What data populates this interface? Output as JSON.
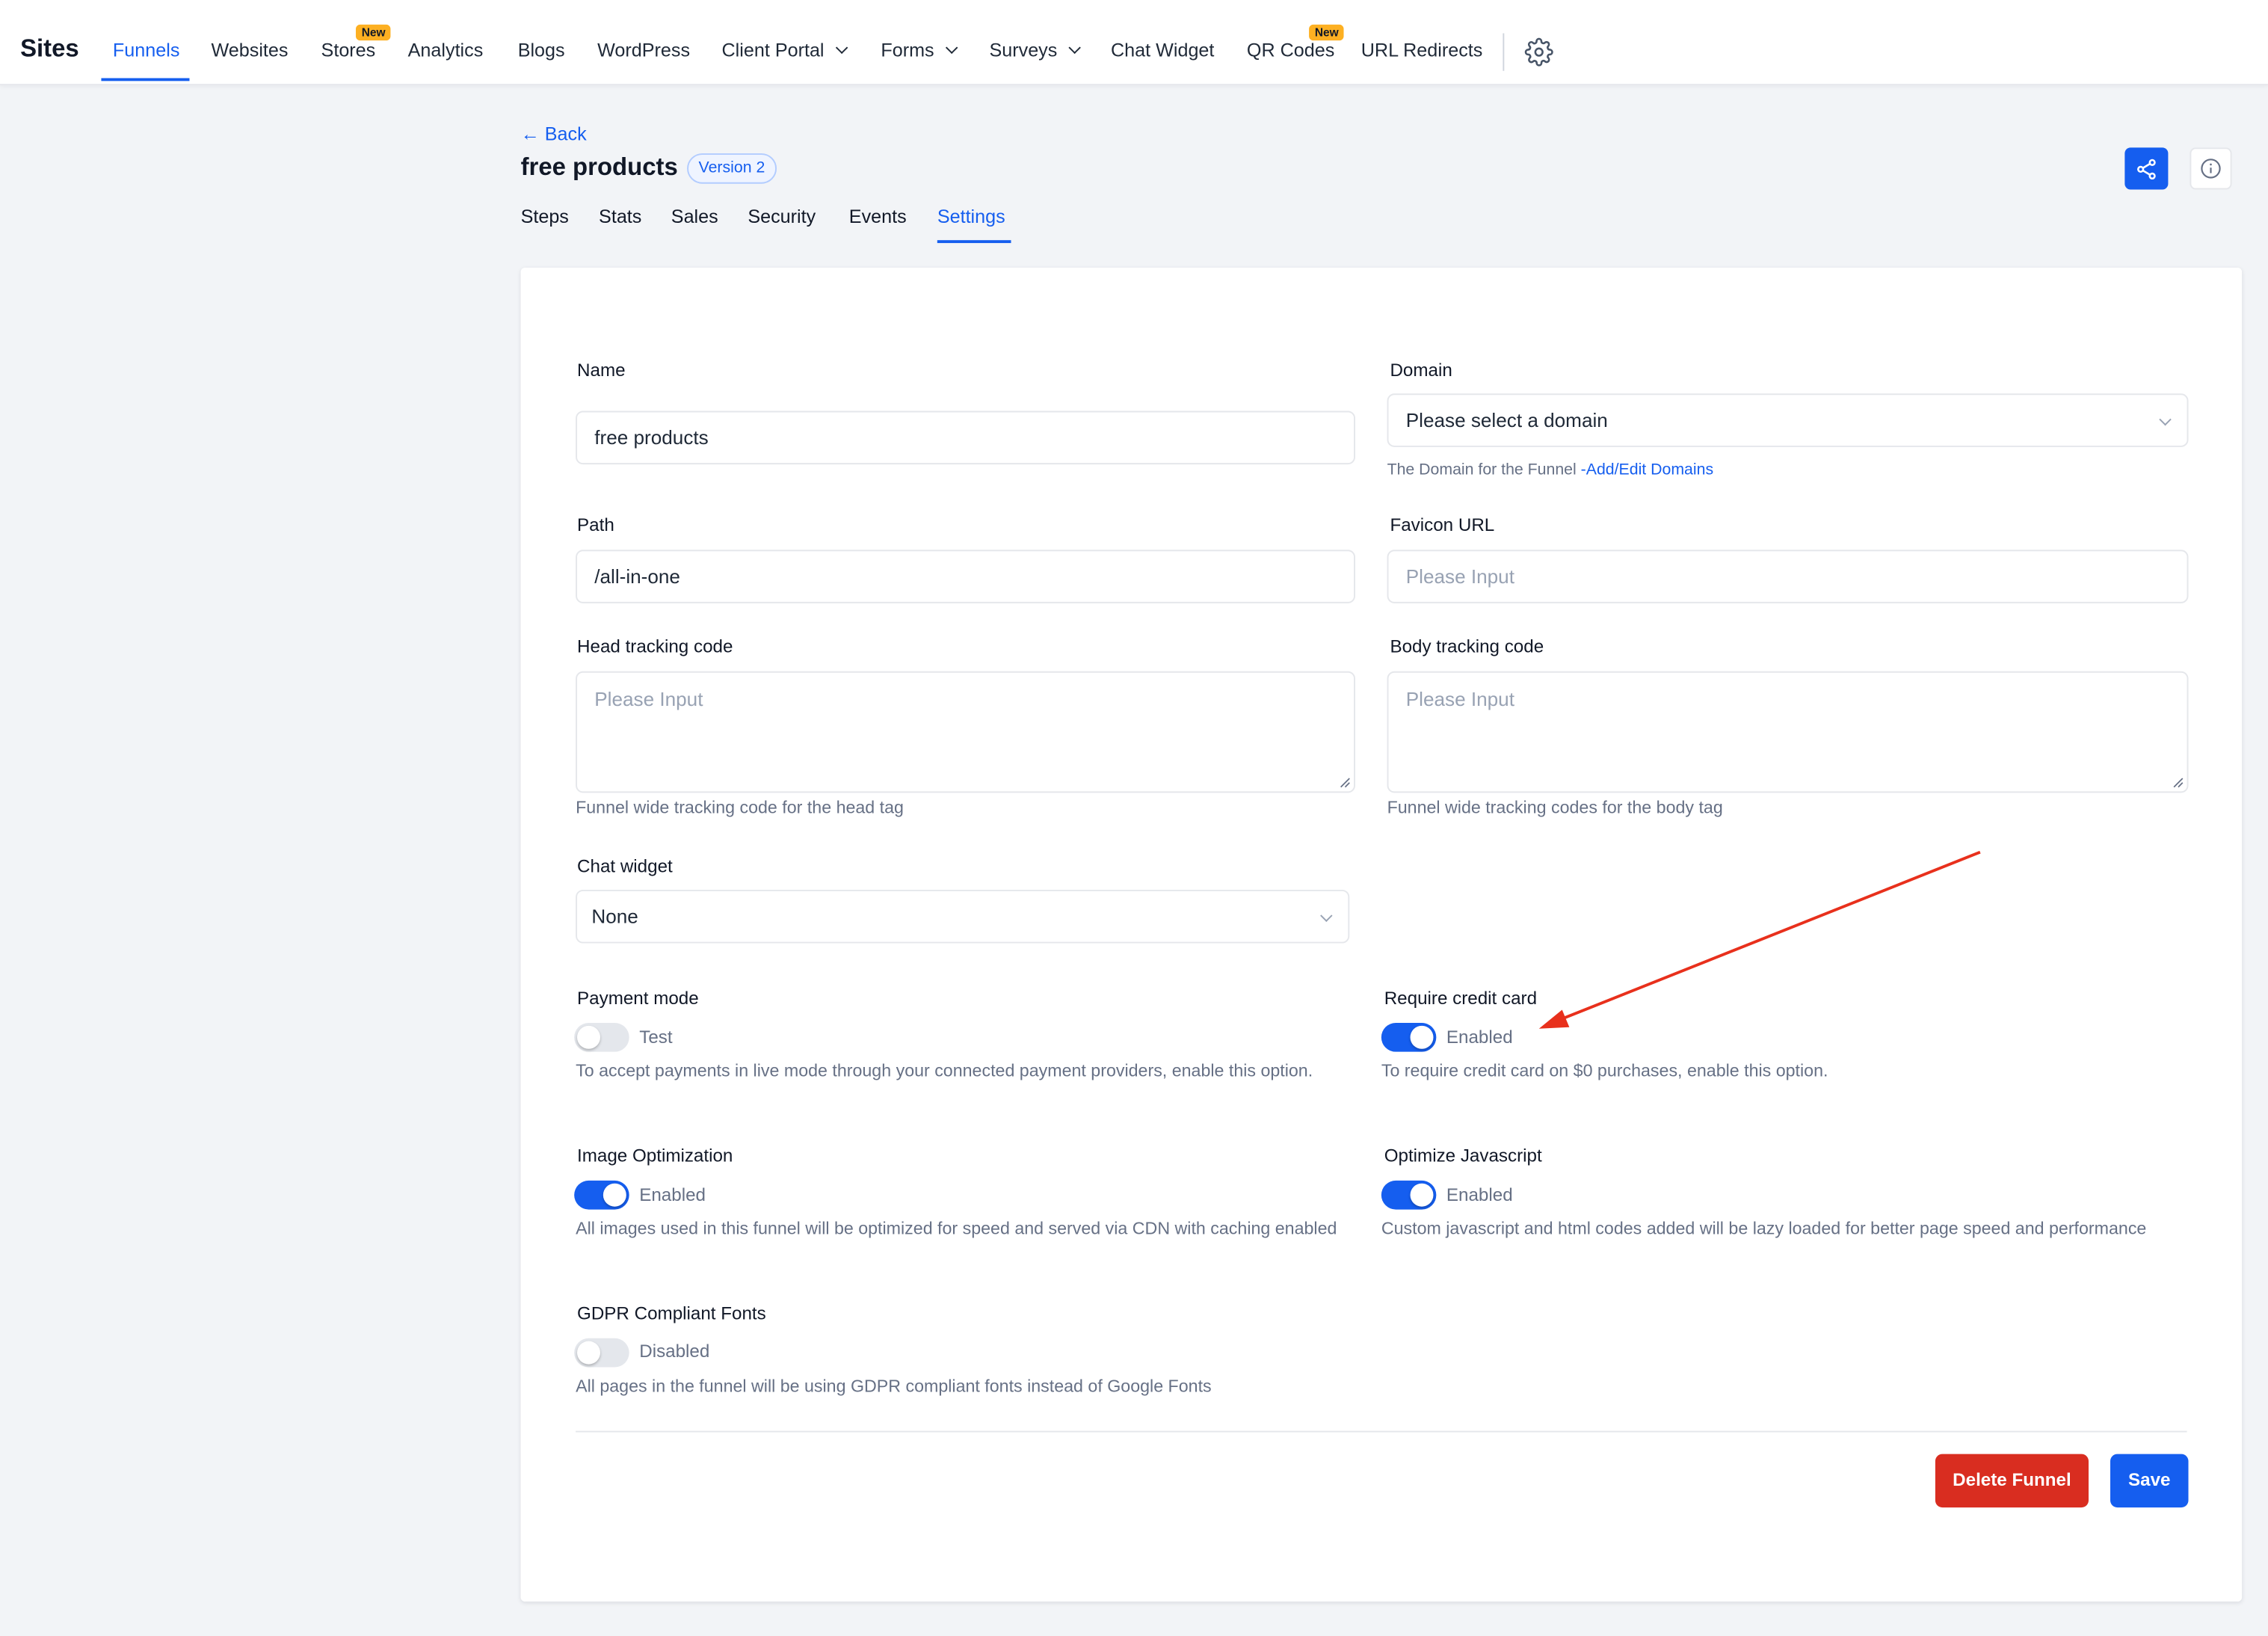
{
  "nav": {
    "brand": "Sites",
    "items": [
      {
        "label": "Funnels"
      },
      {
        "label": "Websites"
      },
      {
        "label": "Stores",
        "badge": "New"
      },
      {
        "label": "Analytics"
      },
      {
        "label": "Blogs"
      },
      {
        "label": "WordPress"
      },
      {
        "label": "Client Portal"
      },
      {
        "label": "Forms"
      },
      {
        "label": "Surveys"
      },
      {
        "label": "Chat Widget"
      },
      {
        "label": "QR Codes",
        "badge": "New"
      },
      {
        "label": "URL Redirects"
      }
    ],
    "active": "Funnels"
  },
  "header": {
    "back": "Back",
    "title": "free products",
    "version": "Version 2",
    "tabs": [
      "Steps",
      "Stats",
      "Sales",
      "Security",
      "Events",
      "Settings"
    ],
    "active_tab": "Settings"
  },
  "form": {
    "name": {
      "label": "Name",
      "value": "free products"
    },
    "domain": {
      "label": "Domain",
      "value": "Please select a domain",
      "help": "The Domain for the Funnel ",
      "help_link": "-Add/Edit Domains"
    },
    "path": {
      "label": "Path",
      "value": "/all-in-one"
    },
    "favicon": {
      "label": "Favicon URL",
      "placeholder": "Please Input"
    },
    "head_tracking": {
      "label": "Head tracking code",
      "placeholder": "Please Input",
      "help": "Funnel wide tracking code for the head tag"
    },
    "body_tracking": {
      "label": "Body tracking code",
      "placeholder": "Please Input",
      "help": "Funnel wide tracking codes for the body tag"
    },
    "chat_widget": {
      "label": "Chat widget",
      "value": "None"
    },
    "payment_mode": {
      "label": "Payment mode",
      "enabled": false,
      "state": "Test",
      "help": "To accept payments in live mode through your connected payment providers, enable this option."
    },
    "require_cc": {
      "label": "Require credit card",
      "enabled": true,
      "state": "Enabled",
      "help": "To require credit card on $0 purchases, enable this option."
    },
    "image_opt": {
      "label": "Image Optimization",
      "enabled": true,
      "state": "Enabled",
      "help": "All images used in this funnel will be optimized for speed and served via CDN with caching enabled"
    },
    "optimize_js": {
      "label": "Optimize Javascript",
      "enabled": true,
      "state": "Enabled",
      "help": "Custom javascript and html codes added will be lazy loaded for better page speed and performance"
    },
    "gdpr_fonts": {
      "label": "GDPR Compliant Fonts",
      "enabled": false,
      "state": "Disabled",
      "help": "All pages in the funnel will be using GDPR compliant fonts instead of Google Fonts"
    }
  },
  "actions": {
    "delete": "Delete Funnel",
    "save": "Save"
  },
  "colors": {
    "accent": "#155eef",
    "danger": "#d92d20",
    "annotation": "#e8301c",
    "badge": "#fdb022"
  },
  "icons": [
    "gear-icon",
    "share-icon",
    "info-icon",
    "back-arrow-icon",
    "chevron-down-icon"
  ]
}
